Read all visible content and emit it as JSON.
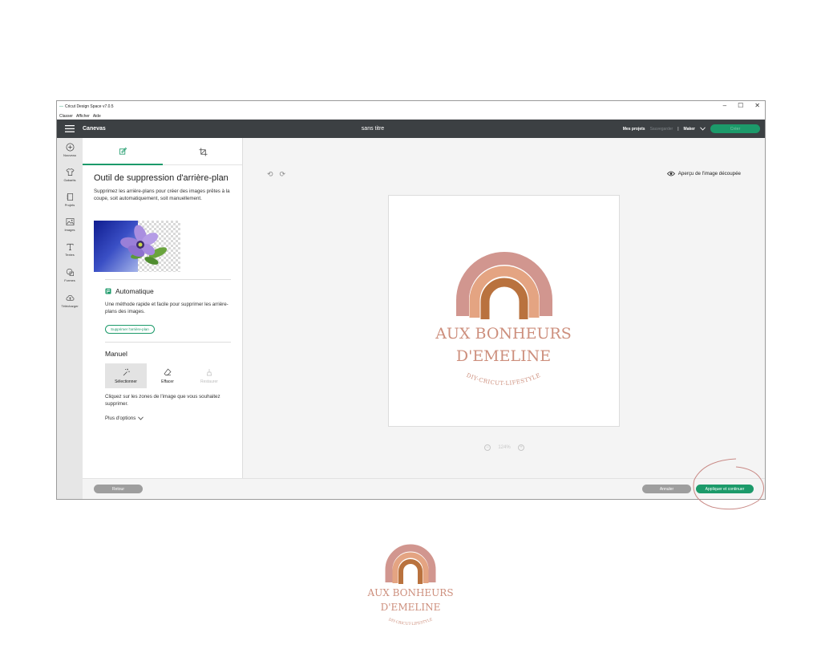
{
  "window": {
    "title": "Cricut Design Space v7.0.5",
    "menu": [
      "Classer",
      "Afficher",
      "Aide"
    ],
    "controls": [
      "–",
      "☐",
      "✕"
    ]
  },
  "appbar": {
    "section": "Canevas",
    "document_title": "sans titre",
    "my_projects": "Mes projets",
    "save": "Sauvegarder",
    "separator": "|",
    "machine": "Maker",
    "create": "Créer"
  },
  "rail": {
    "items": [
      {
        "label": "Nouveau",
        "icon": "plus-icon"
      },
      {
        "label": "Gabarits",
        "icon": "shirt-icon"
      },
      {
        "label": "Projets",
        "icon": "projects-icon"
      },
      {
        "label": "Images",
        "icon": "image-icon"
      },
      {
        "label": "Textes",
        "icon": "text-icon"
      },
      {
        "label": "Formes",
        "icon": "shapes-icon"
      },
      {
        "label": "Télécharger",
        "icon": "upload-icon"
      }
    ]
  },
  "panel": {
    "title": "Outil de suppression d'arrière-plan",
    "description": "Supprimez les arrière-plans pour créer des images prêtes à la coupe, soit automatiquement, soit manuellement.",
    "automatic": {
      "title": "Automatique",
      "description": "Une méthode rapide et facile pour supprimer les arrière-plans des images.",
      "button": "Supprimer l'arrière-plan"
    },
    "manual": {
      "title": "Manuel",
      "tools": [
        {
          "label": "Sélectionner",
          "state": "selected"
        },
        {
          "label": "Effacer",
          "state": "normal"
        },
        {
          "label": "Restaurer",
          "state": "disabled"
        }
      ],
      "description": "Cliquez sur les zones de l'image que vous souhaitez supprimer.",
      "more": "Plus d'options"
    }
  },
  "canvas": {
    "preview_link": "Aperçu de l'image découpée",
    "zoom": "124%",
    "zoom_minus": "−",
    "zoom_plus": "+"
  },
  "bottom": {
    "back": "Retour",
    "cancel": "Annuler",
    "apply": "Appliquer et continuer"
  },
  "logo": {
    "line1": "AUX BONHEURS",
    "line2": "D'EMELINE",
    "tagline": "DIY-CRICUT-LIFESTYLE"
  },
  "colors": {
    "accent": "#1c9a6a",
    "appbar": "#3c4043",
    "logo_text": "#cd8f7d",
    "annotation": "#c98a86"
  }
}
